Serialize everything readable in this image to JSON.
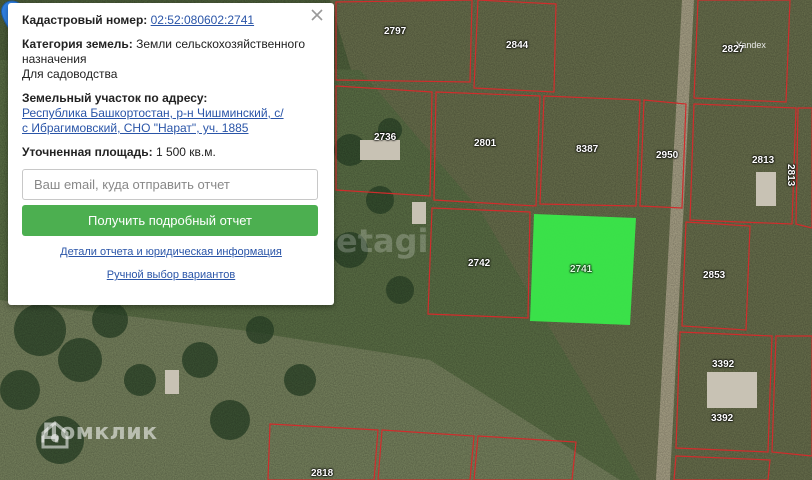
{
  "popup": {
    "cadastral_label": "Кадастровый номер:",
    "cadastral_number": "02:52:080602:2741",
    "category_label": "Категория земель:",
    "category_value_line1": "Земли сельскохозяйственного",
    "category_value_line2": "назначения",
    "usage": "Для садоводства",
    "address_label": "Земельный участок по адресу:",
    "address_line1": "Республика Башкортостан, р-н Чишминский, с/",
    "address_line2": "с Ибрагимовский, СНО \"Нарат\", уч. 1885",
    "area_label": "Уточненная площадь:",
    "area_value": "1 500 кв.м.",
    "email_placeholder": "Ваш email, куда отправить отчет",
    "report_button": "Получить подробный отчет",
    "details_link": "Детали отчета и юридическая информация",
    "manual_link": "Ручной выбор вариантов"
  },
  "map": {
    "attribution": "Yandex",
    "watermark": "Домклик",
    "etagi_watermark": "etagi",
    "selected_color": "#39e84a",
    "parcels": [
      {
        "id": "2797"
      },
      {
        "id": "2844"
      },
      {
        "id": "2827"
      },
      {
        "id": "2736"
      },
      {
        "id": "2801"
      },
      {
        "id": "8387"
      },
      {
        "id": "2950"
      },
      {
        "id": "2813"
      },
      {
        "id": "2813"
      },
      {
        "id": "2742"
      },
      {
        "id": "2741"
      },
      {
        "id": "2853"
      },
      {
        "id": "3392"
      },
      {
        "id": "3392"
      },
      {
        "id": "2818"
      }
    ]
  }
}
